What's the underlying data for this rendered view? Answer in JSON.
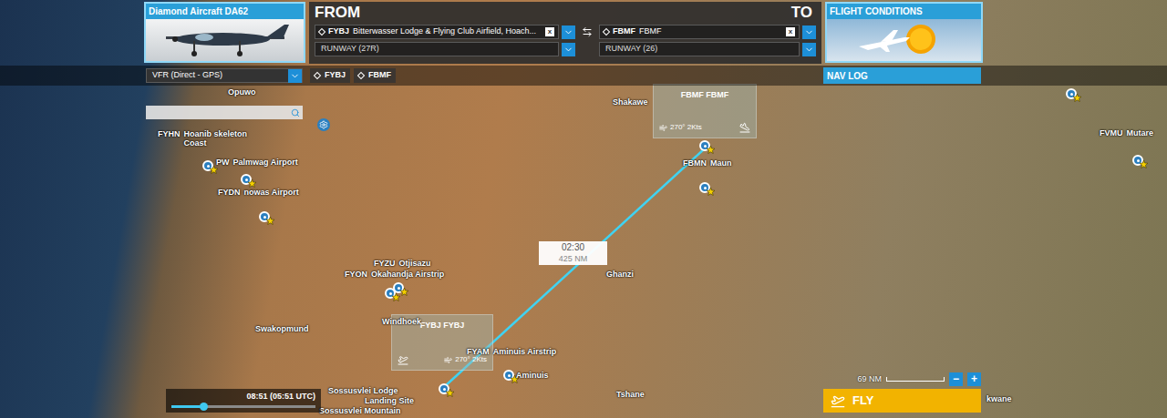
{
  "aircraft": {
    "name": "Diamond Aircraft DA62"
  },
  "from": {
    "heading": "FROM",
    "icao": "FYBJ",
    "name": "Bitterwasser Lodge & Flying Club Airfield, Hoach...",
    "clear": "x",
    "runway": "RUNWAY (27R)"
  },
  "to": {
    "heading": "TO",
    "icao": "FBMF",
    "name": "FBMF",
    "clear": "x",
    "runway": "RUNWAY (26)"
  },
  "flight_conditions": {
    "title": "FLIGHT CONDITIONS"
  },
  "flight_plan": {
    "type": "VFR (Direct - GPS)",
    "waypoints": [
      "FYBJ",
      "FBMF"
    ]
  },
  "nav_log": {
    "title": "NAV LOG"
  },
  "route": {
    "time": "02:30",
    "distance": "425 NM"
  },
  "airport_boxes": [
    {
      "title": "FBMF FBMF",
      "wind": "270° 2Kts",
      "kind": "arrival"
    },
    {
      "title": "FYBJ FYBJ",
      "wind": "270° 2Kts",
      "kind": "departure"
    }
  ],
  "map_labels": [
    {
      "code": "",
      "name": "Opuwo"
    },
    {
      "code": "FYHN",
      "name": "Hoanib skeleton Coast"
    },
    {
      "code": "PW",
      "name": "Palmwag Airport"
    },
    {
      "code": "FYDN",
      "name": "nowas Airport"
    },
    {
      "code": "FYZU",
      "name": "Otjisazu"
    },
    {
      "code": "FYON",
      "name": "Okahandja Airstrip"
    },
    {
      "code": "",
      "name": "Windhoek"
    },
    {
      "code": "",
      "name": "Swakopmund"
    },
    {
      "code": "FYAM",
      "name": "Aminuis Airstrip"
    },
    {
      "code": "",
      "name": "Aminuis"
    },
    {
      "code": "",
      "name": "Ghanzi"
    },
    {
      "code": "",
      "name": "Tshane"
    },
    {
      "code": "",
      "name": "Shakawe"
    },
    {
      "code": "FBMN",
      "name": "Maun"
    },
    {
      "code": "FVMU",
      "name": "Mutare"
    },
    {
      "code": "",
      "name": "Sossusvlei Lodge"
    },
    {
      "code": "",
      "name": "Landing Site"
    },
    {
      "code": "",
      "name": "Sossusvlei Mountain"
    },
    {
      "code": "",
      "name": "kwane"
    }
  ],
  "time_slider": {
    "time": "08:51 (05:51 UTC)",
    "level": 0.22
  },
  "scale": {
    "distance": "69 NM",
    "zoom_out": "−",
    "zoom_in": "+"
  },
  "fly_button": {
    "label": "FLY"
  }
}
